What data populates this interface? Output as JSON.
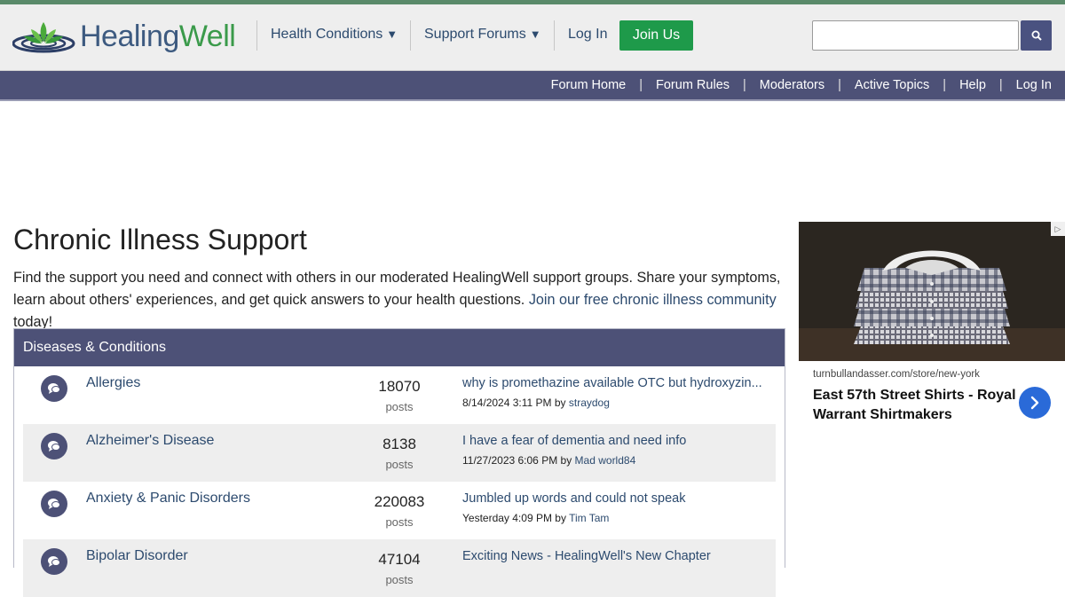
{
  "header": {
    "logo_part1": "Healing",
    "logo_part2": "Well",
    "nav": [
      {
        "label": "Health Conditions",
        "caret": "▼"
      },
      {
        "label": "Support Forums",
        "caret": "▼"
      },
      {
        "label": "Log In"
      }
    ],
    "join_label": "Join Us",
    "search": {
      "placeholder": "",
      "value": "",
      "icon": "search-icon"
    }
  },
  "forum_bar": {
    "links": [
      "Forum Home",
      "Forum Rules",
      "Moderators",
      "Active Topics",
      "Help",
      "Log In"
    ],
    "separator": "|"
  },
  "page": {
    "title": "Chronic Illness Support",
    "intro_text": "Find the support you need and connect with others in our moderated HealingWell support groups. Share your symptoms, learn about others' experiences, and get quick answers to your health questions. ",
    "intro_link": "Join our free chronic illness community",
    "intro_tail": " today!"
  },
  "panel": {
    "title": "Diseases & Conditions",
    "rows": [
      {
        "name": "Allergies",
        "count": "18070",
        "unit": "posts",
        "topic": "why is promethazine available OTC but hydroxyzin...",
        "date": "8/14/2024 3:11 PM by",
        "user": "straydog"
      },
      {
        "name": "Alzheimer's Disease",
        "count": "8138",
        "unit": "posts",
        "topic": "I have a fear of dementia and need info",
        "date": "11/27/2023 6:06 PM by",
        "user": "Mad world84"
      },
      {
        "name": "Anxiety & Panic Disorders",
        "count": "220083",
        "unit": "posts",
        "topic": "Jumbled up words and could not speak",
        "date": "Yesterday 4:09 PM by",
        "user": "Tim Tam"
      },
      {
        "name": "Bipolar Disorder",
        "count": "47104",
        "unit": "posts",
        "topic": "Exciting News - HealingWell's New Chapter",
        "date": "",
        "user": ""
      }
    ]
  },
  "ad": {
    "domain": "turnbullandasser.com/store/new-york",
    "title": "East 57th Street Shirts - Royal Warrant Shirtmakers",
    "choice_icon": "ad-choices-icon",
    "arrow_icon": "chevron-right-icon"
  },
  "colors": {
    "brand_navy": "#4d5177",
    "brand_green": "#1e9a4a",
    "link": "#2c4a6e"
  }
}
